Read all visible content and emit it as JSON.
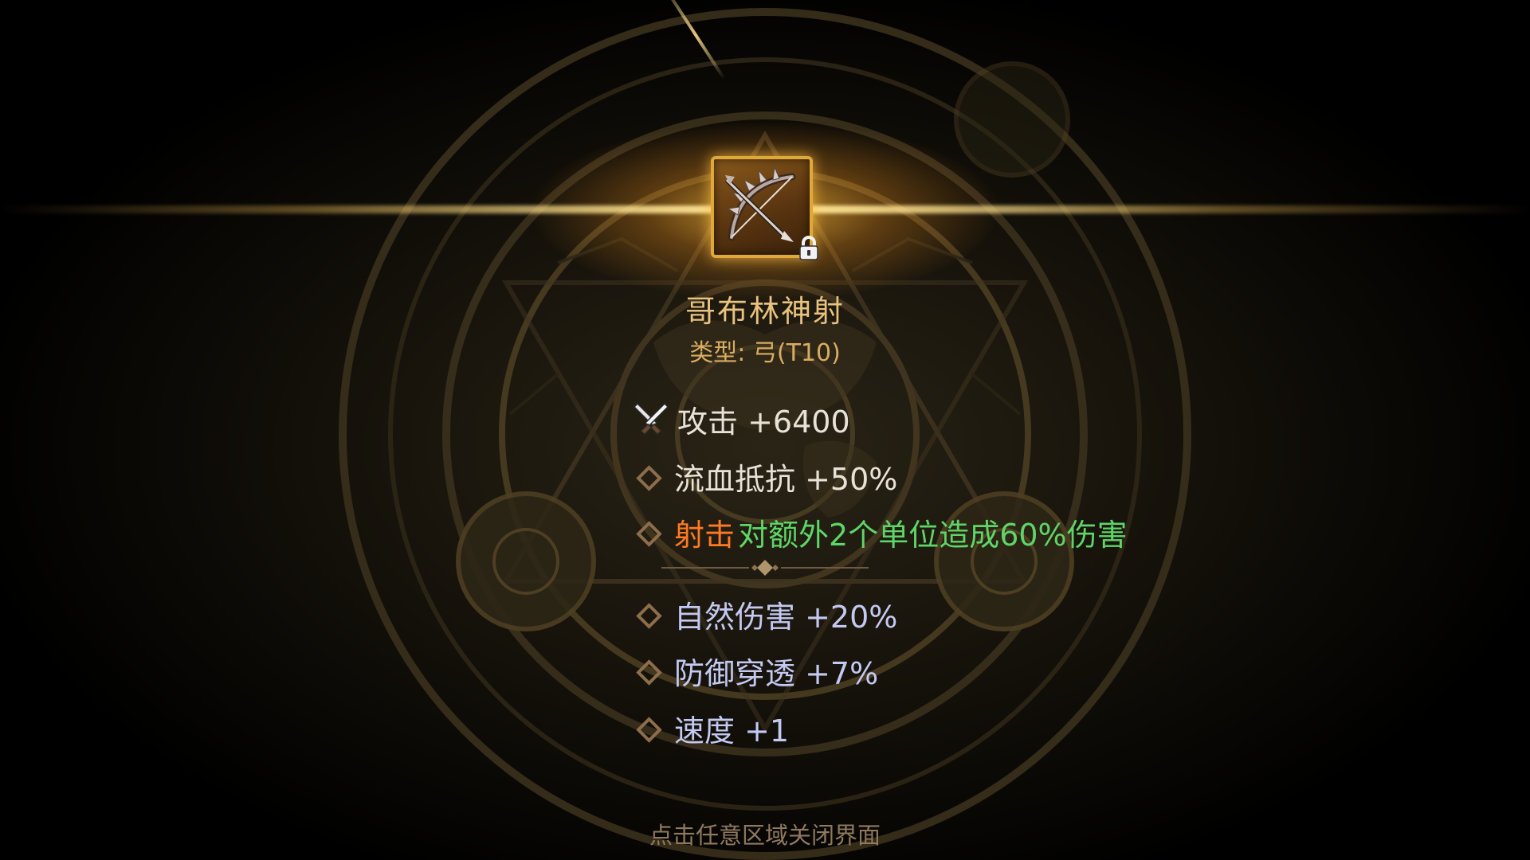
{
  "item": {
    "name": "哥布林神射",
    "type_line": "类型: 弓(T10)",
    "icon": "bow-icon",
    "locked": true
  },
  "base_stats": [
    {
      "icon": "crossed-swords-icon",
      "label": "攻击 +6400"
    },
    {
      "icon": "diamond-bullet-icon",
      "label": "流血抵抗 +50%"
    }
  ],
  "skill": {
    "icon": "diamond-bullet-icon",
    "name": "射击",
    "description": "对额外2个单位造成60%伤害"
  },
  "bonus_stats": [
    {
      "icon": "diamond-bullet-icon",
      "label": "自然伤害 +20%"
    },
    {
      "icon": "diamond-bullet-icon",
      "label": "防御穿透 +7%"
    },
    {
      "icon": "diamond-bullet-icon",
      "label": "速度 +1"
    }
  ],
  "close_hint": "点击任意区域关闭界面",
  "colors": {
    "title": "#e8c27e",
    "skill_name": "#ff7a22",
    "skill_desc": "#5ed667",
    "bonus_stat": "#c4c9f2",
    "base_stat": "#e9e2d6",
    "frame": "#e0a838"
  }
}
